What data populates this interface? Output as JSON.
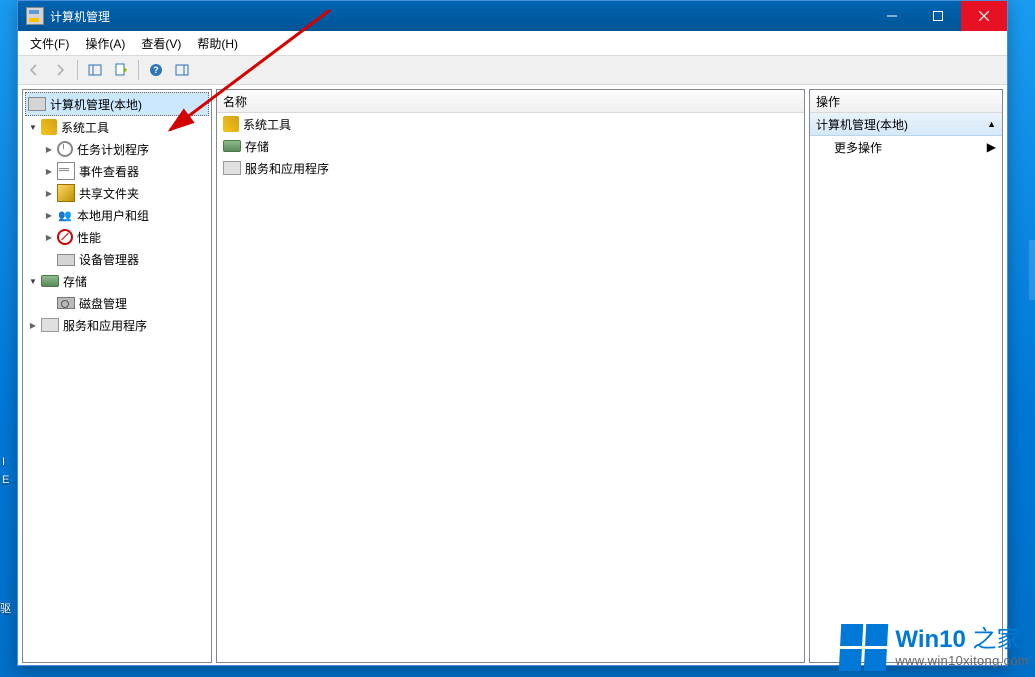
{
  "titlebar": {
    "title": "计算机管理"
  },
  "menus": {
    "file": "文件(F)",
    "action": "操作(A)",
    "view": "查看(V)",
    "help": "帮助(H)"
  },
  "tree": {
    "root": "计算机管理(本地)",
    "system_tools": "系统工具",
    "task_scheduler": "任务计划程序",
    "event_viewer": "事件查看器",
    "shared_folders": "共享文件夹",
    "local_users": "本地用户和组",
    "performance": "性能",
    "device_manager": "设备管理器",
    "storage": "存储",
    "disk_management": "磁盘管理",
    "services_apps": "服务和应用程序"
  },
  "mid": {
    "header": "名称",
    "items": {
      "tools": "系统工具",
      "storage": "存储",
      "services": "服务和应用程序"
    }
  },
  "actions": {
    "header": "操作",
    "subheader": "计算机管理(本地)",
    "more": "更多操作"
  },
  "watermark": {
    "brand_a": "Win10",
    "brand_b": "之家",
    "url": "www.win10xitong.com"
  },
  "desktop": {
    "label1": "I",
    "label2": "E",
    "label3": "驱"
  }
}
